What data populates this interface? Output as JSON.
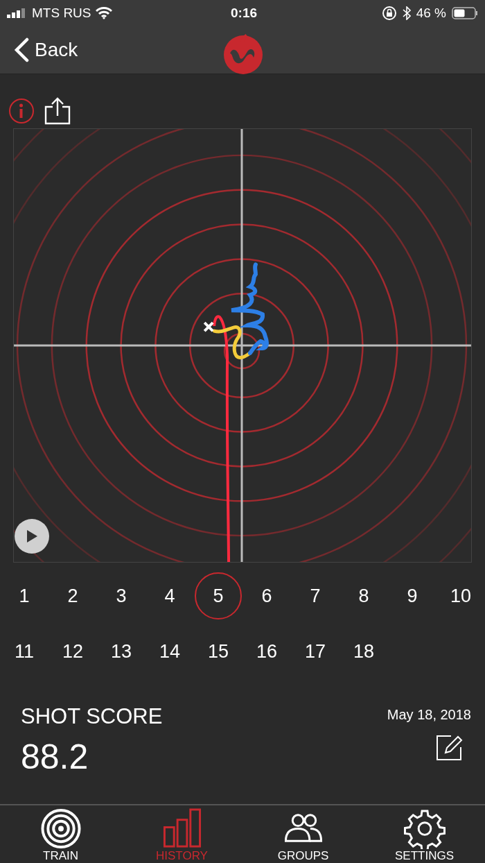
{
  "status_bar": {
    "carrier": "MTS RUS",
    "time": "0:16",
    "battery": "46 %"
  },
  "nav": {
    "back": "Back"
  },
  "shots": [
    {
      "label": "1",
      "selected": false
    },
    {
      "label": "2",
      "selected": false
    },
    {
      "label": "3",
      "selected": false
    },
    {
      "label": "4",
      "selected": false
    },
    {
      "label": "5",
      "selected": true
    },
    {
      "label": "6",
      "selected": false
    },
    {
      "label": "7",
      "selected": false
    },
    {
      "label": "8",
      "selected": false
    },
    {
      "label": "9",
      "selected": false
    },
    {
      "label": "10",
      "selected": false
    },
    {
      "label": "11",
      "selected": false
    },
    {
      "label": "12",
      "selected": false
    },
    {
      "label": "13",
      "selected": false
    },
    {
      "label": "14",
      "selected": false
    },
    {
      "label": "15",
      "selected": false
    },
    {
      "label": "16",
      "selected": false
    },
    {
      "label": "17",
      "selected": false
    },
    {
      "label": "18",
      "selected": false
    }
  ],
  "score": {
    "title": "SHOT SCORE",
    "value": "88.2",
    "date": "May 18, 2018"
  },
  "tab_bar": [
    {
      "label": "TRAIN",
      "kind": "target",
      "selected": false
    },
    {
      "label": "HISTORY",
      "kind": "bars",
      "selected": true
    },
    {
      "label": "GROUPS",
      "kind": "people",
      "selected": false
    },
    {
      "label": "SETTINGS",
      "kind": "gear",
      "selected": false
    }
  ]
}
